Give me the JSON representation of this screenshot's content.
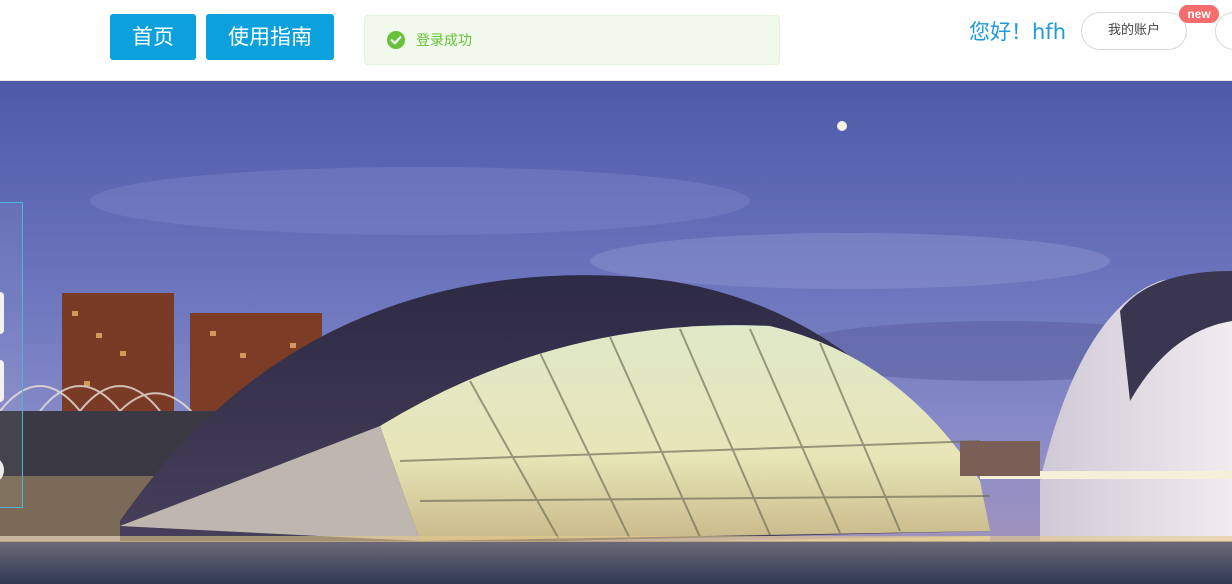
{
  "nav": {
    "home_label": "首页",
    "guide_label": "使用指南"
  },
  "notification": {
    "text": "登录成功",
    "icon": "check-circle-icon",
    "color": "#67c23a"
  },
  "user": {
    "greeting": "您好！hfh",
    "account_button": "我的账户",
    "badge": "new"
  },
  "hero": {
    "description": "City of Arts and Sciences at dusk"
  },
  "colors": {
    "accent": "#0ca0dc",
    "success": "#67c23a",
    "badge": "#f56c6c",
    "greeting": "#1e9adf"
  }
}
